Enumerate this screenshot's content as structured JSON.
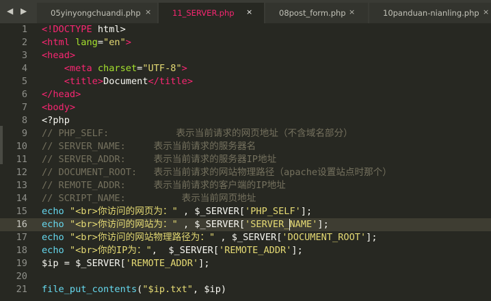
{
  "tabs": [
    {
      "label": "05yinyongchuandi.php",
      "close": "×",
      "active": false
    },
    {
      "label": "11_SERVER.php",
      "close": "×",
      "active": true
    },
    {
      "label": "08post_form.php",
      "close": "×",
      "active": false
    },
    {
      "label": "10panduan-nianling.php",
      "close": "×",
      "active": false
    }
  ],
  "nav": {
    "back": "◀",
    "forward": "▶"
  },
  "lines": [
    {
      "num": "1",
      "tokens": [
        [
          "t",
          "<!"
        ],
        [
          "t",
          "DOCTYPE"
        ],
        [
          "p",
          " html>"
        ]
      ]
    },
    {
      "num": "2",
      "tokens": [
        [
          "t",
          "<html"
        ],
        [
          "p",
          " "
        ],
        [
          "a",
          "lang"
        ],
        [
          "p",
          "="
        ],
        [
          "s",
          "\"en\""
        ],
        [
          "t",
          ">"
        ]
      ]
    },
    {
      "num": "3",
      "tokens": [
        [
          "t",
          "<head>"
        ]
      ]
    },
    {
      "num": "4",
      "tokens": [
        [
          "p",
          "    "
        ],
        [
          "t",
          "<meta"
        ],
        [
          "p",
          " "
        ],
        [
          "a",
          "charset"
        ],
        [
          "p",
          "="
        ],
        [
          "s",
          "\"UTF-8\""
        ],
        [
          "t",
          ">"
        ]
      ]
    },
    {
      "num": "5",
      "tokens": [
        [
          "p",
          "    "
        ],
        [
          "t",
          "<title>"
        ],
        [
          "p",
          "Document"
        ],
        [
          "t",
          "</title>"
        ]
      ]
    },
    {
      "num": "6",
      "tokens": [
        [
          "t",
          "</head>"
        ]
      ]
    },
    {
      "num": "7",
      "tokens": [
        [
          "t",
          "<body>"
        ]
      ]
    },
    {
      "num": "8",
      "tokens": [
        [
          "p",
          "<?php"
        ]
      ]
    },
    {
      "num": "9",
      "tokens": [
        [
          "c",
          "// PHP_SELF:            表示当前请求的网页地址（不含域名部分）"
        ]
      ]
    },
    {
      "num": "10",
      "tokens": [
        [
          "c",
          "// SERVER_NAME:     表示当前请求的服务器名"
        ]
      ]
    },
    {
      "num": "11",
      "tokens": [
        [
          "c",
          "// SERVER_ADDR:     表示当前请求的服务器IP地址"
        ]
      ]
    },
    {
      "num": "12",
      "tokens": [
        [
          "c",
          "// DOCUMENT_ROOT:   表示当前请求的网站物理路径（apache设置站点时那个）"
        ]
      ]
    },
    {
      "num": "13",
      "tokens": [
        [
          "c",
          "// REMOTE_ADDR:     表示当前请求的客户端的IP地址"
        ]
      ]
    },
    {
      "num": "14",
      "tokens": [
        [
          "c",
          "// SCRIPT_NAME:          表示当前网页地址"
        ]
      ]
    },
    {
      "num": "15",
      "tokens": [
        [
          "k",
          "echo"
        ],
        [
          "p",
          " "
        ],
        [
          "s",
          "\"<br>你访问的网页为：\""
        ],
        [
          "p",
          " , $_SERVER["
        ],
        [
          "s",
          "'PHP_SELF'"
        ],
        [
          "p",
          "];"
        ]
      ]
    },
    {
      "num": "16",
      "current": true,
      "caret_after": 4,
      "tokens": [
        [
          "k",
          "echo"
        ],
        [
          "p",
          " "
        ],
        [
          "s",
          "\"<br>你访问的网站为：\""
        ],
        [
          "p",
          " , $_SERVER["
        ],
        [
          "s",
          "'SERVER_"
        ],
        [
          "s",
          "NAME'"
        ],
        [
          "p",
          "];"
        ]
      ]
    },
    {
      "num": "17",
      "tokens": [
        [
          "k",
          "echo"
        ],
        [
          "p",
          " "
        ],
        [
          "s",
          "\"<br>你访问的网站物理路径为：\""
        ],
        [
          "p",
          " , $_SERVER["
        ],
        [
          "s",
          "'DOCUMENT_ROOT'"
        ],
        [
          "p",
          "];"
        ]
      ]
    },
    {
      "num": "18",
      "tokens": [
        [
          "k",
          "echo"
        ],
        [
          "p",
          " "
        ],
        [
          "s",
          "\"<br>你的IP为：\""
        ],
        [
          "p",
          ",  $_SERVER["
        ],
        [
          "s",
          "'REMOTE_ADDR'"
        ],
        [
          "p",
          "];"
        ]
      ]
    },
    {
      "num": "19",
      "tokens": [
        [
          "p",
          "$ip = $_SERVER["
        ],
        [
          "s",
          "'REMOTE_ADDR'"
        ],
        [
          "p",
          "];"
        ]
      ]
    },
    {
      "num": "20",
      "tokens": []
    },
    {
      "num": "21",
      "tokens": [
        [
          "k",
          "file_put_contents"
        ],
        [
          "p",
          "("
        ],
        [
          "s",
          "\"$ip.txt\""
        ],
        [
          "p",
          ", $ip)"
        ]
      ]
    }
  ],
  "colors": {
    "background": "#272822",
    "tag": "#f92672",
    "attribute": "#a6e22e",
    "string": "#e6db74",
    "keyword": "#66d9ef",
    "comment": "#75715e",
    "text": "#f8f8f2"
  }
}
